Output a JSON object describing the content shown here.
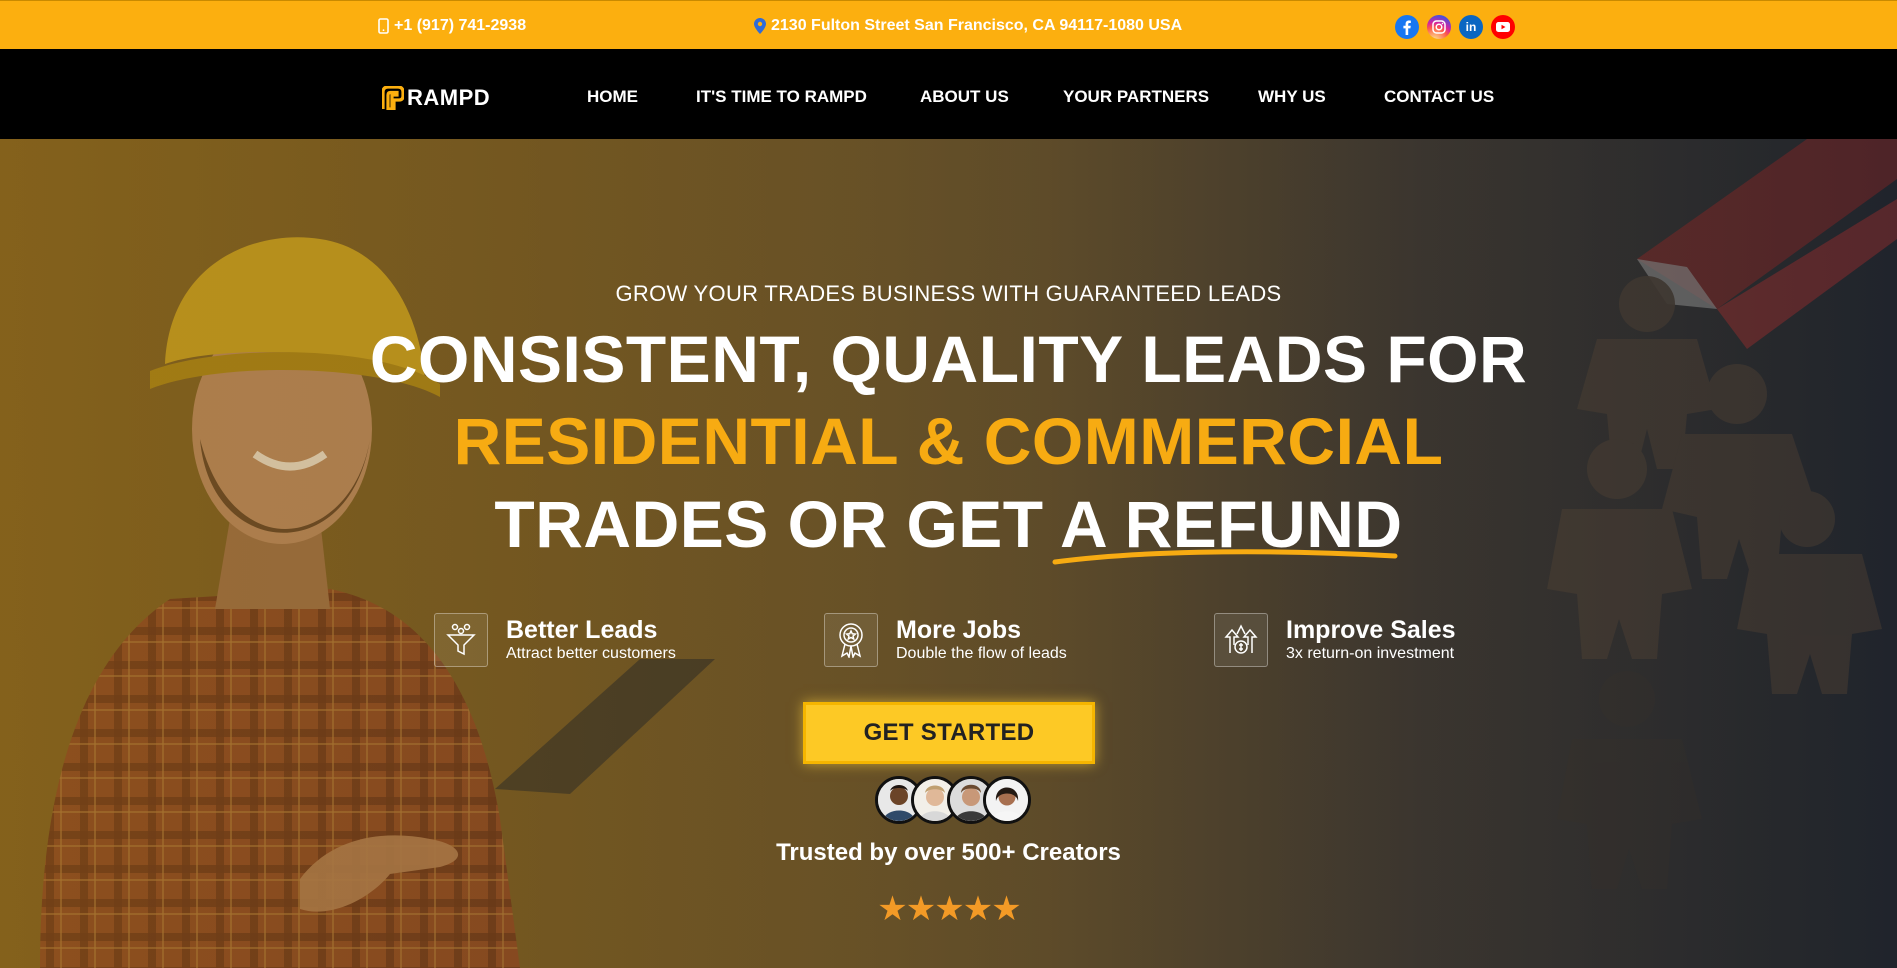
{
  "topbar": {
    "phone": "+1 (917) 741-2938",
    "address": "2130 Fulton Street San Francisco, CA 94117-1080 USA",
    "socials": [
      {
        "name": "facebook-icon"
      },
      {
        "name": "instagram-icon"
      },
      {
        "name": "linkedin-icon"
      },
      {
        "name": "youtube-icon"
      }
    ]
  },
  "nav": {
    "logo_text": "RAMPD",
    "items": [
      {
        "label": "HOME"
      },
      {
        "label": "IT'S TIME TO RAMPD"
      },
      {
        "label": "ABOUT US"
      },
      {
        "label": "YOUR PARTNERS"
      },
      {
        "label": "WHY US"
      },
      {
        "label": "CONTACT US"
      }
    ]
  },
  "hero": {
    "kicker": "GROW YOUR TRADES BUSINESS WITH GUARANTEED LEADS",
    "line1": "CONSISTENT, QUALITY LEADS FOR",
    "line2": "RESIDENTIAL & COMMERCIAL",
    "line3_a": "TRADES OR GET ",
    "line3_b": "A REFUND",
    "features": [
      {
        "title": "Better Leads",
        "subtitle": "Attract better customers",
        "icon": "funnel-icon"
      },
      {
        "title": "More Jobs",
        "subtitle": "Double the flow of leads",
        "icon": "award-badge-icon"
      },
      {
        "title": "Improve Sales",
        "subtitle": "3x return-on investment",
        "icon": "growth-coin-icon"
      }
    ],
    "cta_label": "GET STARTED",
    "trusted_text": "Trusted by over 500+ Creators",
    "stars": "★★★★★",
    "rating": 5
  },
  "colors": {
    "topbar": "#fcaf0f",
    "accent": "#f7ab12",
    "cta": "#fdc925",
    "star": "#f39a26"
  }
}
